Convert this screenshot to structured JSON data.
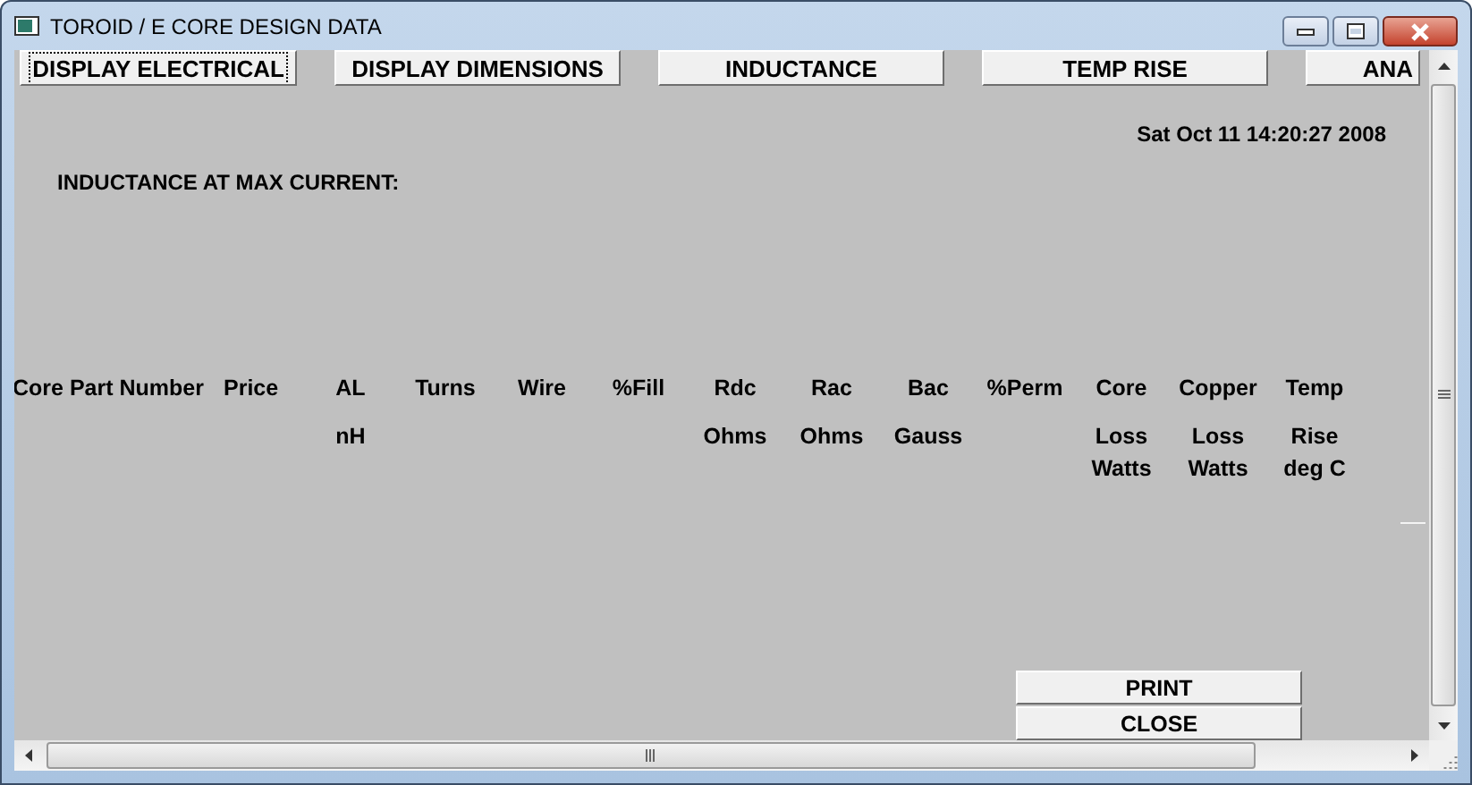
{
  "window": {
    "title": "TOROID / E CORE DESIGN DATA"
  },
  "tabs": [
    {
      "label": "DISPLAY ELECTRICAL",
      "focused": true
    },
    {
      "label": "DISPLAY DIMENSIONS",
      "focused": false
    },
    {
      "label": "INDUCTANCE",
      "focused": false
    },
    {
      "label": "TEMP RISE",
      "focused": false
    },
    {
      "label": "ANA",
      "focused": false
    }
  ],
  "timestamp": "Sat Oct 11 14:20:27 2008",
  "heading": "INDUCTANCE AT MAX CURRENT:",
  "columns": [
    {
      "title": "Core Part Number"
    },
    {
      "title": "Price"
    },
    {
      "title": "AL",
      "units": [
        "nH"
      ]
    },
    {
      "title": "Turns"
    },
    {
      "title": "Wire"
    },
    {
      "title": "%Fill"
    },
    {
      "title": "Rdc",
      "units": [
        "Ohms"
      ]
    },
    {
      "title": "Rac",
      "units": [
        "Ohms"
      ]
    },
    {
      "title": "Bac",
      "units": [
        "Gauss"
      ]
    },
    {
      "title": "%Perm"
    },
    {
      "title": "Core",
      "units": [
        "Loss",
        "Watts"
      ]
    },
    {
      "title": "Copper",
      "units": [
        "Loss",
        "Watts"
      ]
    },
    {
      "title": "Temp",
      "units": [
        "Rise",
        "deg C"
      ]
    }
  ],
  "buttons": [
    "PRINT",
    "CLOSE"
  ]
}
